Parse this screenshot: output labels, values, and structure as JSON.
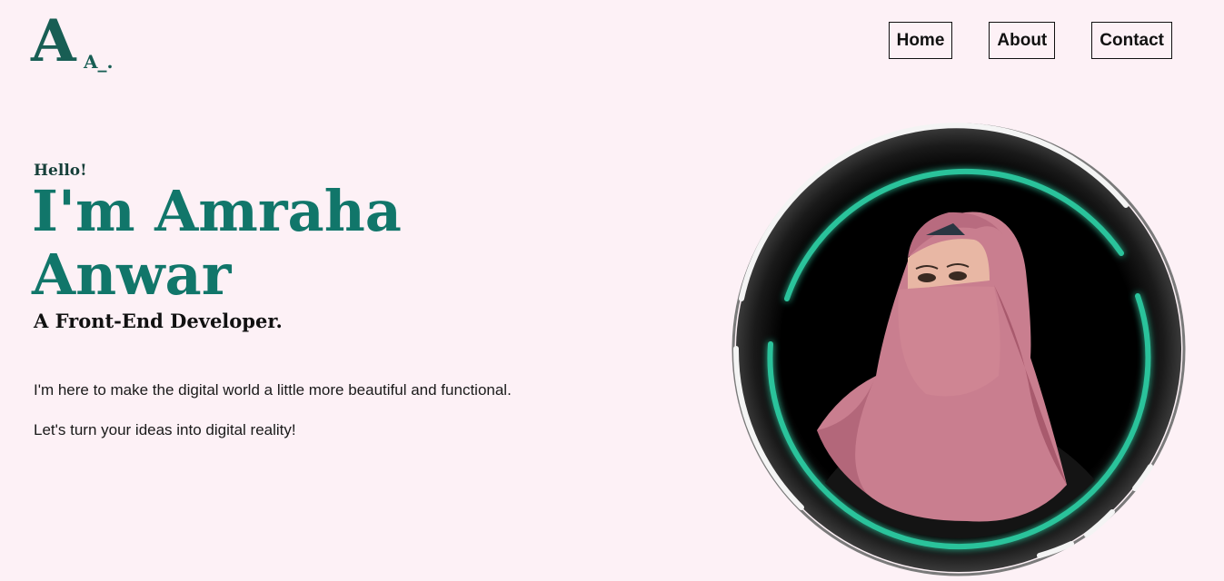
{
  "logo": {
    "big": "A",
    "small": "A_."
  },
  "nav": {
    "items": [
      {
        "label": "Home"
      },
      {
        "label": "About"
      },
      {
        "label": "Contact"
      }
    ]
  },
  "hero": {
    "greeting": "Hello!",
    "name_line1": "I'm Amraha",
    "name_line2": "Anwar",
    "role": "A Front-End Developer.",
    "intro": "I'm here to make the digital world a little more beautiful and functional.",
    "cta": "Let's turn your ideas into digital reality!"
  },
  "colors": {
    "background": "#fdf1f6",
    "accent": "#11766a",
    "ring_glow": "#2cc39b",
    "logo": "#185e54"
  }
}
